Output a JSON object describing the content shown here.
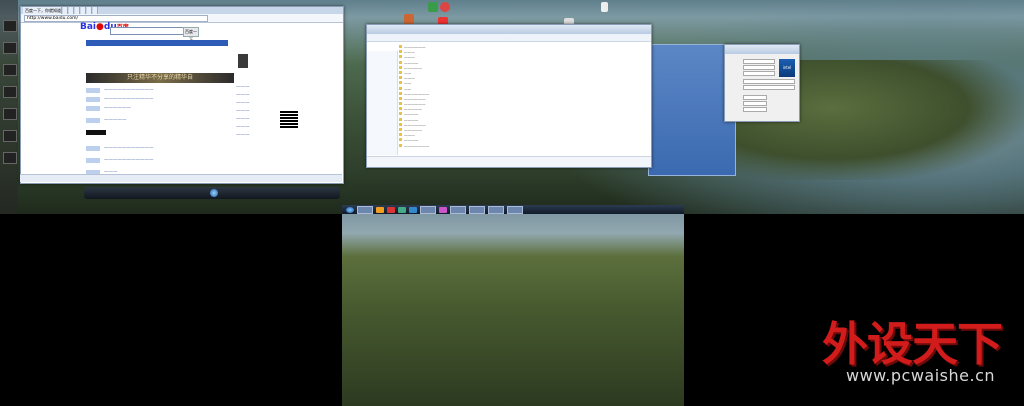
{
  "browser": {
    "tabs": [
      "百度一下，你就知道",
      "",
      "",
      "",
      "",
      "",
      "",
      "",
      ""
    ],
    "address": "http://www.baidu.com/",
    "search_button": "百度一下",
    "nav": [
      "新闻",
      "网页",
      "贴吧"
    ],
    "banner_text": "只注精华不分享的精华自",
    "logo_bai": "Bai",
    "logo_du": "du",
    "logo_suffix": "百度"
  },
  "explorer": {
    "title": "",
    "files": [
      "",
      "",
      "",
      "",
      "",
      "",
      "",
      "",
      "",
      "",
      "",
      "",
      "",
      "",
      "",
      "",
      "",
      "",
      "",
      ""
    ]
  },
  "cpuz": {
    "logo_text": "intel"
  },
  "taskbar": {
    "time": ""
  },
  "watermark": {
    "title": "外设天下",
    "url": "www.pcwaishe.cn"
  },
  "colors": {
    "accent": "#d21b1b",
    "taskbar": "#1b2a40",
    "baidu_blue": "#2932e1"
  }
}
